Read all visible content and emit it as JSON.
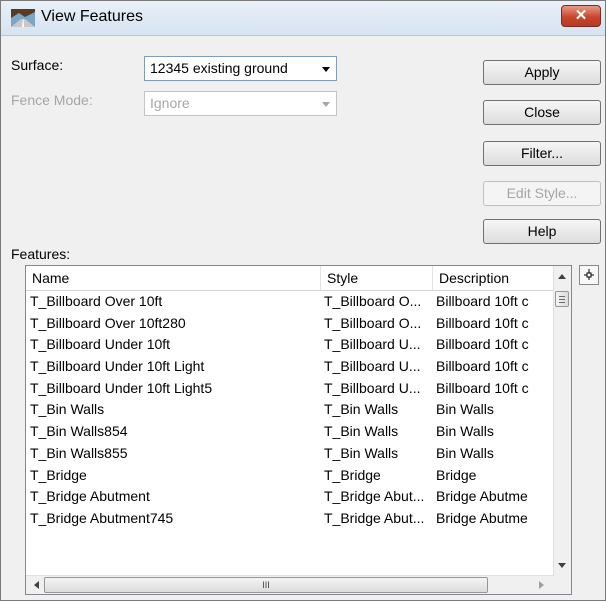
{
  "window": {
    "title": "View Features",
    "close_glyph": "✕"
  },
  "form": {
    "surface_label": "Surface:",
    "surface_value": "12345 existing ground",
    "fence_mode_label": "Fence Mode:",
    "fence_mode_value": "Ignore",
    "features_label": "Features:"
  },
  "buttons": {
    "apply": "Apply",
    "close": "Close",
    "filter": "Filter...",
    "edit_style": "Edit Style...",
    "help": "Help"
  },
  "list": {
    "columns": [
      "Name",
      "Style",
      "Description"
    ],
    "rows": [
      [
        "T_Billboard Over 10ft",
        "T_Billboard O...",
        "Billboard 10ft c"
      ],
      [
        "T_Billboard Over 10ft280",
        "T_Billboard O...",
        "Billboard 10ft c"
      ],
      [
        "T_Billboard Under 10ft",
        "T_Billboard U...",
        "Billboard 10ft c"
      ],
      [
        "T_Billboard Under 10ft Light",
        "T_Billboard U...",
        "Billboard 10ft c"
      ],
      [
        "T_Billboard Under 10ft Light5",
        "T_Billboard U...",
        "Billboard 10ft c"
      ],
      [
        "T_Bin Walls",
        "T_Bin Walls",
        "Bin Walls"
      ],
      [
        "T_Bin Walls854",
        "T_Bin Walls",
        "Bin Walls"
      ],
      [
        "T_Bin Walls855",
        "T_Bin Walls",
        "Bin Walls"
      ],
      [
        "T_Bridge",
        "T_Bridge",
        "Bridge"
      ],
      [
        "T_Bridge Abutment",
        "T_Bridge Abut...",
        "Bridge Abutme"
      ],
      [
        "T_Bridge Abutment745",
        "T_Bridge Abut...",
        "Bridge Abutme"
      ]
    ],
    "hscroll_thumb_glyph": "III"
  },
  "icons": {
    "app": "road-landscape-icon",
    "pin": "pin-icon"
  },
  "colors": {
    "close_button": "#c74730",
    "disabled_text": "#a6a6a6"
  }
}
